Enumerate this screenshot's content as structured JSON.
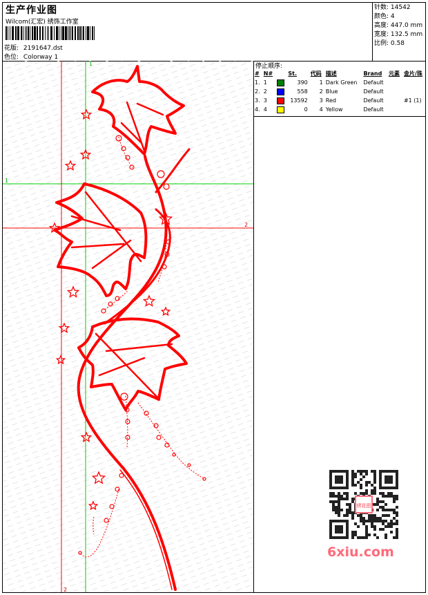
{
  "header": {
    "title": "生产作业图",
    "subtitle": "Wilcom(汇宏) 绣饰工作室",
    "design_label": "花版:",
    "design_value": "2191647.dst",
    "colorway_label": "色位:",
    "colorway_value": "Colorway 1"
  },
  "stats": [
    {
      "label": "针数:",
      "value": "14542"
    },
    {
      "label": "颜色:",
      "value": "4"
    },
    {
      "label": "高度:",
      "value": "447.0 mm"
    },
    {
      "label": "宽度:",
      "value": "132.5 mm"
    },
    {
      "label": "比例:",
      "value": "0.58"
    }
  ],
  "stop_sequence": {
    "title": "停止顺序:",
    "columns": [
      "#",
      "N#",
      "St.",
      "代码",
      "描述",
      "Brand",
      "元素",
      "金片/珠"
    ],
    "rows": [
      {
        "idx": "1.",
        "n": "1",
        "color": "#008000",
        "st": "390",
        "code": "1",
        "desc": "Dark Green",
        "brand": "Default",
        "element": "",
        "sequin": ""
      },
      {
        "idx": "2.",
        "n": "2",
        "color": "#0000ff",
        "st": "558",
        "code": "2",
        "desc": "Blue",
        "brand": "Default",
        "element": "",
        "sequin": ""
      },
      {
        "idx": "3.",
        "n": "3",
        "color": "#ff0000",
        "st": "13592",
        "code": "3",
        "desc": "Red",
        "brand": "Default",
        "element": "",
        "sequin": "#1 (1)"
      },
      {
        "idx": "4.",
        "n": "4",
        "color": "#ffff00",
        "st": "0",
        "code": "4",
        "desc": "Yellow",
        "brand": "Default",
        "element": "",
        "sequin": ""
      }
    ]
  },
  "guides": {
    "green_v_label": "1",
    "green_h_label": "1",
    "red_h_label": "2",
    "red_v_label": "2",
    "green_color": "#00cc00",
    "red_color": "#ff0000"
  },
  "watermark": {
    "text": "6xiu.com",
    "stamp": "绣花图"
  },
  "colors": {
    "embroidery": "#ff0000"
  }
}
